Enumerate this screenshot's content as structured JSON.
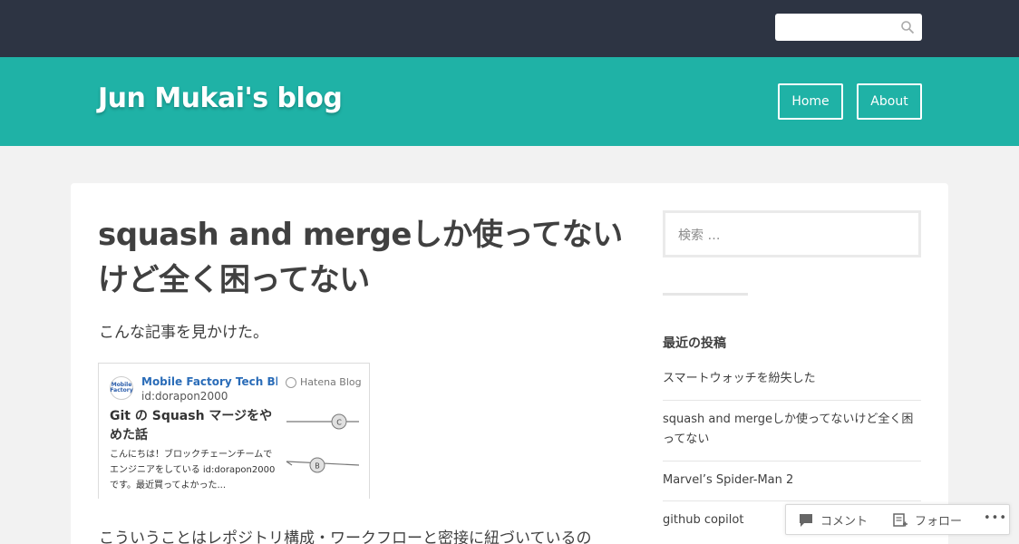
{
  "header": {
    "site_title": "Jun Mukai's blog",
    "nav": [
      {
        "label": "Home"
      },
      {
        "label": "About"
      }
    ]
  },
  "topbar": {
    "search_icon": "search-icon",
    "colors": {
      "bar": "#2d3443",
      "header": "#1fb2a6"
    }
  },
  "post": {
    "title": "squash and mergeしか使ってないけど全く困ってない",
    "intro": "こんな記事を見かけた。",
    "body_start": "こういうことはレポジトリ構成・ワークフローと密接に紐づいているの",
    "embed": {
      "blog_name": "Mobile Factory Tech Bl...",
      "favicon_text": "Mobile Factory",
      "author": "id:dorapon2000",
      "service": "Hatena Blog",
      "article_title": "Git の Squash マージをやめた話",
      "excerpt": "こんにちは！ブロックチェーンチームでエンジニアをしている id:dorapon2000 です。最近買ってよかった...",
      "thumb_nodes": [
        "C",
        "B"
      ]
    }
  },
  "sidebar": {
    "search_placeholder": "検索 …",
    "recent_title": "最近の投稿",
    "recent_posts": [
      "スマートウォッチを紛失した",
      "squash and mergeしか使ってないけど全く困ってない",
      "Marvel’s Spider-Man 2",
      "github copilot"
    ]
  },
  "action_bar": {
    "comment_label": "コメント",
    "follow_label": "フォロー",
    "more_label": "•••"
  }
}
